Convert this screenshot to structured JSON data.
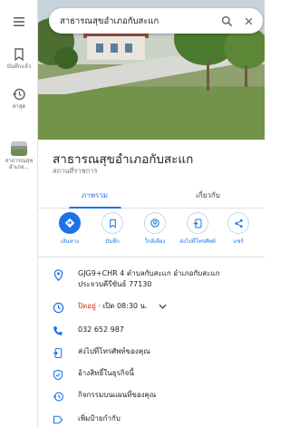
{
  "rail": {
    "items": [
      {
        "label": ""
      },
      {
        "label": "บันทึกแล้ว"
      },
      {
        "label": "ล่าสุด"
      },
      {
        "label": "สาธารณสุข อำเภอ..."
      }
    ]
  },
  "search": {
    "value": "สาธารณสุขอำเภอกับสะแก"
  },
  "place": {
    "name": "สาธารณสุขอำเภอกับสะแก",
    "category": "สถานที่ราชการ"
  },
  "tabs": [
    {
      "label": "ภาพรวม"
    },
    {
      "label": "เกี่ยวกับ"
    }
  ],
  "actions": [
    {
      "label": "เส้นทาง"
    },
    {
      "label": "บันทึก"
    },
    {
      "label": "ใกล้เคียง"
    },
    {
      "label": "ส่งไปที่โทรศัพท์"
    },
    {
      "label": "แชร์"
    }
  ],
  "details": {
    "address_line1": "GJG9+CHR 4 ตำบลกับสะแก อำเภอกับสะแก",
    "address_line2": "ประจวบคีรีขันธ์ 77130",
    "hours_status": "ปิดอยู่",
    "hours_rest": " · เปิด 08:30 น.",
    "phone": "032 652 987",
    "send_to_phone": "ส่งไปที่โทรศัพท์ของคุณ",
    "claim": "อ้างสิทธิ์ในธุรกิจนี้",
    "activity": "กิจกรรมบนแผนที่ของคุณ",
    "label": "เพิ่มป้ายกำกับ"
  },
  "colors": {
    "accent": "#1a73e8",
    "closed": "#d93025"
  }
}
